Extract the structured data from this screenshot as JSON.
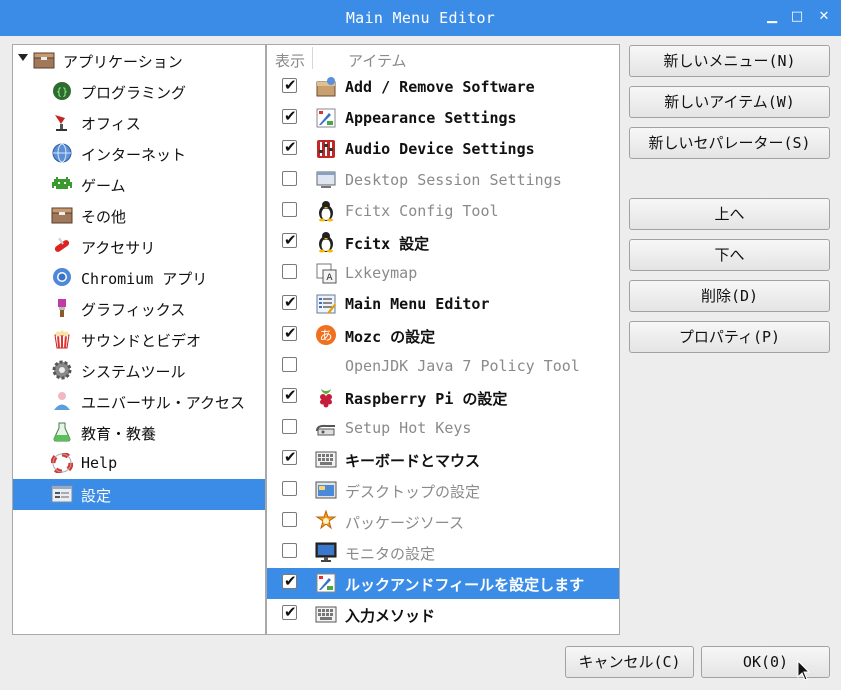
{
  "window": {
    "title": "Main Menu Editor",
    "minimize_glyph": "▁",
    "maximize_glyph": "□",
    "close_glyph": "✕"
  },
  "tree": {
    "root_label": "アプリケーション",
    "items": [
      {
        "label": "プログラミング",
        "icon": "programming-icon"
      },
      {
        "label": "オフィス",
        "icon": "office-icon"
      },
      {
        "label": "インターネット",
        "icon": "internet-globe-icon"
      },
      {
        "label": "ゲーム",
        "icon": "game-invader-icon"
      },
      {
        "label": "その他",
        "icon": "other-box-icon"
      },
      {
        "label": "アクセサリ",
        "icon": "accessories-knife-icon"
      },
      {
        "label": "Chromium アプリ",
        "icon": "chromium-icon"
      },
      {
        "label": "グラフィックス",
        "icon": "graphics-brush-icon"
      },
      {
        "label": "サウンドとビデオ",
        "icon": "sound-video-popcorn-icon"
      },
      {
        "label": "システムツール",
        "icon": "system-gear-icon"
      },
      {
        "label": "ユニバーサル・アクセス",
        "icon": "accessibility-person-icon"
      },
      {
        "label": "教育・教養",
        "icon": "education-flask-icon"
      },
      {
        "label": "Help",
        "icon": "help-lifebuoy-icon"
      },
      {
        "label": "設定",
        "icon": "settings-icon"
      }
    ],
    "selected": "設定"
  },
  "list": {
    "header_show": "表示",
    "header_item": "アイテム",
    "items": [
      {
        "label": "Add / Remove Software",
        "checked": true,
        "icon": "package-icon"
      },
      {
        "label": "Appearance Settings",
        "checked": true,
        "icon": "appearance-icon"
      },
      {
        "label": "Audio Device Settings",
        "checked": true,
        "icon": "audio-mixer-icon"
      },
      {
        "label": "Desktop Session Settings",
        "checked": false,
        "icon": "desktop-session-icon"
      },
      {
        "label": "Fcitx Config Tool",
        "checked": false,
        "icon": "penguin-icon"
      },
      {
        "label": "Fcitx 設定",
        "checked": true,
        "icon": "penguin-icon"
      },
      {
        "label": "Lxkeymap",
        "checked": false,
        "icon": "keymap-icon"
      },
      {
        "label": "Main Menu Editor",
        "checked": true,
        "icon": "menu-editor-icon"
      },
      {
        "label": "Mozc の設定",
        "checked": true,
        "icon": "mozc-icon"
      },
      {
        "label": "OpenJDK Java 7 Policy Tool",
        "checked": false,
        "icon": ""
      },
      {
        "label": "Raspberry Pi の設定",
        "checked": true,
        "icon": "raspberry-icon"
      },
      {
        "label": "Setup Hot Keys",
        "checked": false,
        "icon": "hotkeys-icon"
      },
      {
        "label": "キーボードとマウス",
        "checked": true,
        "icon": "keyboard-icon"
      },
      {
        "label": "デスクトップの設定",
        "checked": false,
        "icon": "desktop-icon"
      },
      {
        "label": "パッケージソース",
        "checked": false,
        "icon": "package-source-icon"
      },
      {
        "label": "モニタの設定",
        "checked": false,
        "icon": "monitor-icon"
      },
      {
        "label": "ルックアンドフィールを設定します",
        "checked": true,
        "icon": "appearance-icon",
        "selected": true
      },
      {
        "label": "入力メソッド",
        "checked": true,
        "icon": "keyboard-icon"
      }
    ]
  },
  "buttons": {
    "new_menu": "新しいメニュー(N)",
    "new_item": "新しいアイテム(W)",
    "new_separator": "新しいセパレーター(S)",
    "move_up": "上へ",
    "move_down": "下へ",
    "delete": "削除(D)",
    "properties": "プロパティ(P)",
    "cancel": "キャンセル(C)",
    "ok": "OK(0)"
  },
  "colors": {
    "accent": "#3b8ce6",
    "background": "#ededed",
    "dim_text": "#8a8a8a"
  }
}
